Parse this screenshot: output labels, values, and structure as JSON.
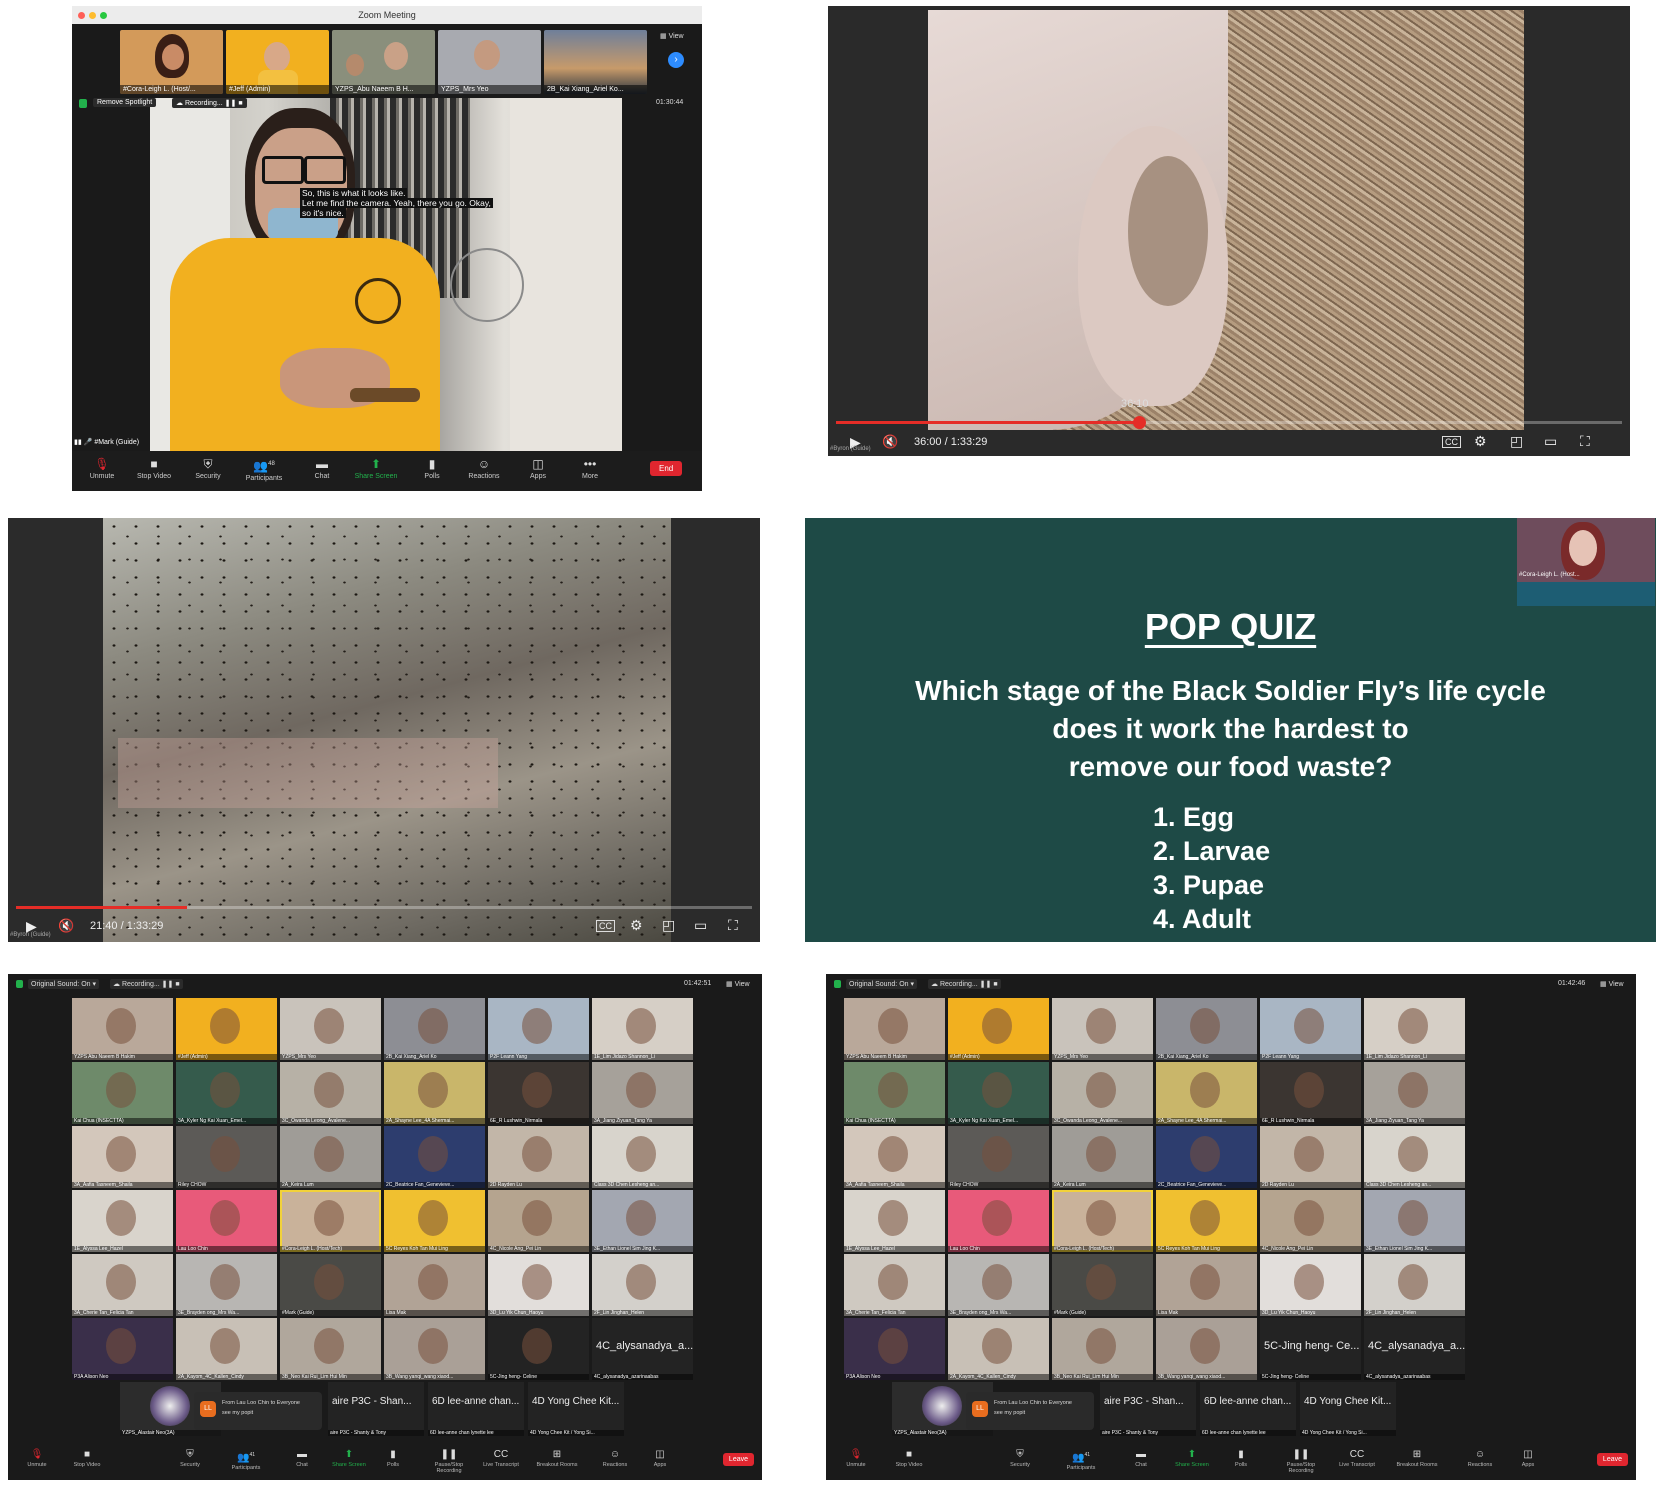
{
  "panel1": {
    "window_title": "Zoom Meeting",
    "view_label": "View",
    "participants": [
      "#Cora-Leigh L. (Host/...",
      "#Jeff (Admin)",
      "YZPS_Abu Naeem B H...",
      "YZPS_Mrs Yeo",
      "2B_Kai Xiang_Ariel Ko..."
    ],
    "remove_spotlight": "Remove Spotlight",
    "recording": "Recording...",
    "timer": "01:30:44",
    "caption": [
      "So, this is what it looks like.",
      "Let me find the camera. Yeah, there you go. Okay,",
      "so it's nice."
    ],
    "speaker": "#Mark (Guide)",
    "toolbar": [
      "Unmute",
      "Stop Video",
      "Security",
      "Participants",
      "Chat",
      "Share Screen",
      "Polls",
      "Reactions",
      "Apps",
      "More"
    ],
    "participant_count": "48",
    "end_label": "End"
  },
  "panel2": {
    "hover_time": "36:10",
    "time_display": "36:00 / 1:33:29",
    "progress": 0.385,
    "cc": "CC",
    "watermark": "#Byron (Guide)"
  },
  "panel3": {
    "time_display": "21:40 / 1:33:29",
    "progress": 0.232,
    "cc": "CC",
    "watermark": "#Byron (Guide)"
  },
  "panel4": {
    "title": "POP QUIZ",
    "question": [
      "Which stage of the Black Soldier Fly’s life cycle",
      "does it work the hardest to",
      "remove our food waste?"
    ],
    "options": [
      "1.  Egg",
      "2. Larvae",
      "3. Pupae",
      "4. Adult"
    ],
    "host_label": "#Cora-Leigh L. (Host..."
  },
  "gallery": {
    "original_sound": "Original Sound: On",
    "recording": "Recording...",
    "timer_left": "01:42:51",
    "timer_right": "01:42:46",
    "view": "View",
    "labels_left": [
      "YZPS Abu Naeem B Hakim",
      "#Jeff (Admin)",
      "YZPS_Mrs Yeo",
      "2B_Kai Xiang_Ariel Ko",
      "P2F Leann Yang",
      "1E_Lim Jidazo Shannon_Li",
      "Kai Chua (INSECTTA)",
      "3A_Kyler Ng Kai Xuan_Emel...",
      "3C_Owanda Leong_Avalene...",
      "2A_Shayne Lee_4A Shermai...",
      "6E_R Lushwin_Nirmala",
      "3A_Jiang Ziyuan_Tang Ya",
      "3A_Aafia Tasneem_Shaila",
      "Riley CHOW",
      "2A_Keira Lum",
      "2C_Beatrice Fan_Genevieve...",
      "2D Rayden Lu",
      "Class 3D Chen Lesheng an...",
      "1E_Alyssa Lee_Hazel",
      "Lau Loo Chin",
      "#Cora-Leigh L. (Host/Tech)",
      "5C Reyes Koh Tan Mui Ling",
      "4C_Nicole Ang_Pei Lin",
      "3E_Ethan Lionel Sim Jing K...",
      "3A_Cherie Tan_Felicia Tan",
      "3E_Brayden ong_Mrs Wa...",
      "#Mark (Guide)",
      "Lisa Mak",
      "3D_Lu Yik Chun_Haoyu",
      "2F_Lin Jinghan_Helen",
      "P3A Alison Neo",
      "2A_Kayom_4C_Kallen_Cindy",
      "3B_Neo Kai Rui_Lim Hui Min",
      "3B_Wang yanqi_wang xiaod...",
      "5C-Jing heng- Celine",
      "4C_alysanadya_azarinaabas"
    ],
    "big_names": {
      "cell_34_right": "5C-Jing heng- Ce...",
      "cell_35": "4C_alysanadya_a..."
    },
    "bottom_row": [
      "aire P3C - Shan...",
      "6D lee-anne chan...",
      "4D Yong Chee Kit..."
    ],
    "bottom_row_sub": [
      "aire P3C - Shanty & Tony",
      "6D lee-anne chan lynette lee",
      "4D Yong Chee Kit / Yong Si..."
    ],
    "chat_from": "From Lau Loo Chin to Everyone",
    "chat_msg": "see my popit",
    "chat_avatar": "LL",
    "self_label": "YZPS_Alastair Neo(3A)",
    "toolbar": [
      "Unmute",
      "Stop Video",
      "Security",
      "Participants",
      "Chat",
      "Share Screen",
      "Polls",
      "Pause/Stop Recording",
      "Live Transcript",
      "Breakout Rooms",
      "Reactions",
      "Apps"
    ],
    "participant_count": "41",
    "leave": "Leave"
  },
  "colors": {
    "quiz_bg": "#1e4a46",
    "yt_red": "#e52d27",
    "zoom_green": "#22b14c",
    "shirt": "#f2b01f"
  }
}
